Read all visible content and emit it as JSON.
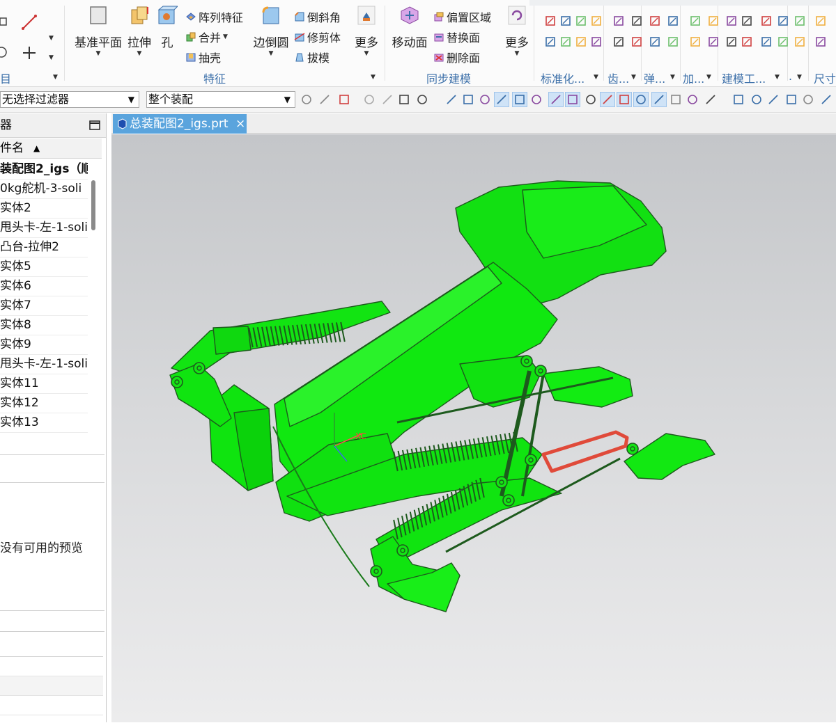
{
  "ribbon": {
    "left_partial_label": "目",
    "feature_group": {
      "label": "特征",
      "datum_plane": "基准平面",
      "extrude": "拉伸",
      "hole": "孔",
      "pattern_feature": "阵列特征",
      "unite": "合并",
      "shell": "抽壳",
      "edge_blend": "边倒圆",
      "chamfer": "倒斜角",
      "trim_body": "修剪体",
      "draft": "拔模",
      "more": "更多"
    },
    "sync_group": {
      "label": "同步建模",
      "move_face": "移动面",
      "offset_region": "偏置区域",
      "replace_face": "替换面",
      "delete_face": "删除面",
      "more": "更多"
    },
    "right_groups": [
      "标准化...",
      "齿...",
      "弹...",
      "加...",
      "建模工...",
      ".",
      "尺寸"
    ]
  },
  "toolbar2": {
    "filter_value": "无选择过滤器",
    "scope_value": "整个装配"
  },
  "left_panel": {
    "title": "器",
    "column_header": "件名",
    "rows": [
      "装配图2_igs（顺",
      "0kg舵机-3-soli",
      "实体2",
      "甩头卡-左-1-soli",
      "凸台-拉伸2",
      "实体5",
      "实体6",
      "实体7",
      "实体8",
      "实体9",
      "甩头卡-左-1-soli",
      "实体11",
      "实体12",
      "实体13"
    ],
    "preview_text": "没有可用的预览"
  },
  "document_tab": {
    "title": "总装配图2_igs.prt",
    "close": "×"
  },
  "viewport": {
    "model_color": "#10e810",
    "axis_label": "XC",
    "background_top": "#c4c6c9",
    "background_bottom": "#ececed"
  },
  "colors": {
    "accent_blue": "#5aa4dd",
    "group_label": "#3a6ea8",
    "model_green": "#10e810"
  }
}
